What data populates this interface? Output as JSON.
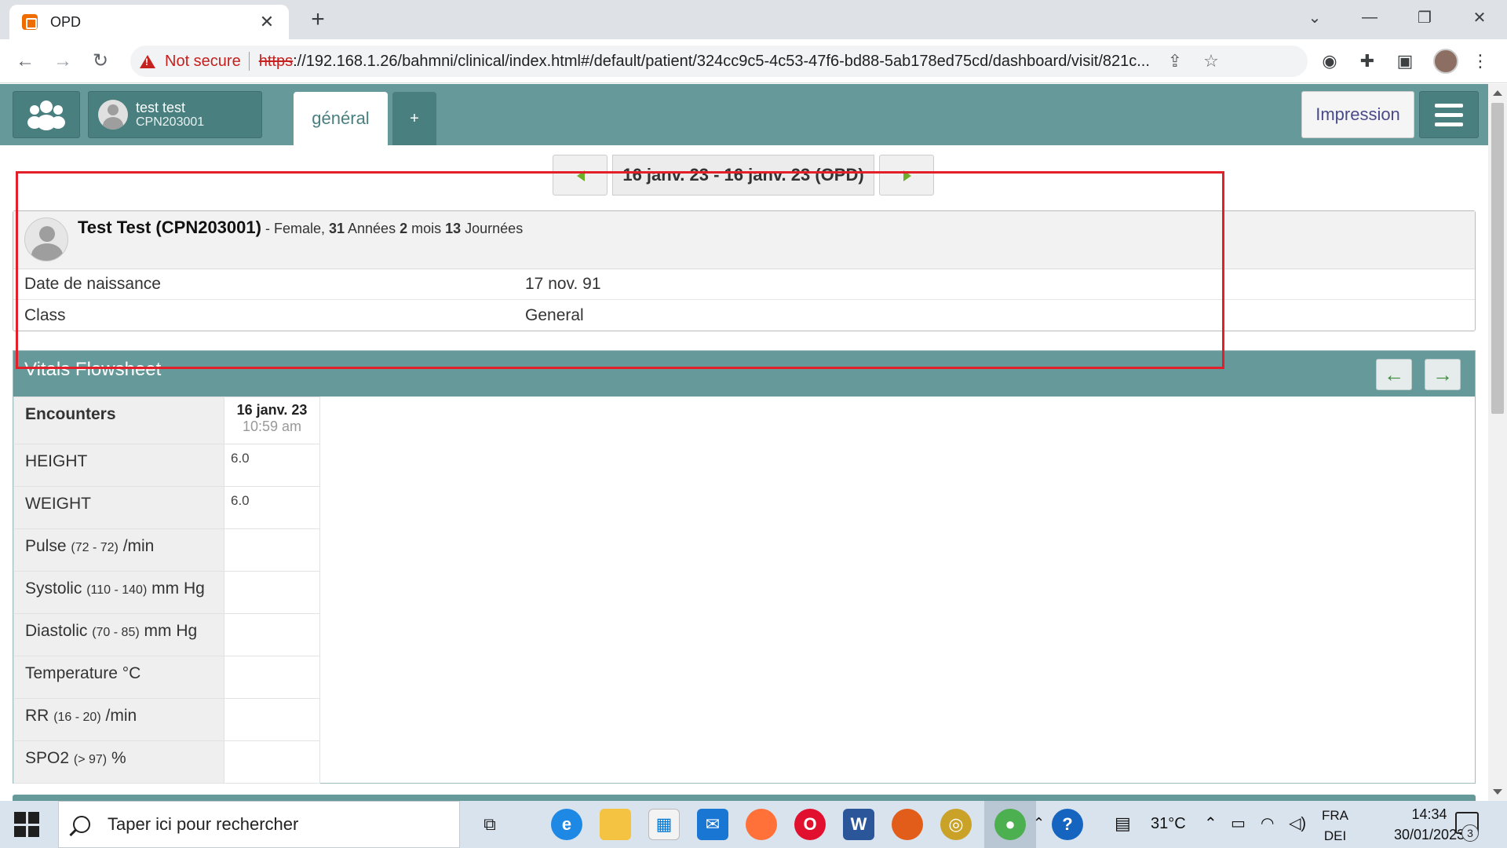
{
  "browser": {
    "tab_title": "OPD",
    "new_tab_label": "+",
    "not_secure": "Not secure",
    "url_scheme": "https",
    "url_rest": "://192.168.1.26/bahmni/clinical/index.html#/default/patient/324cc9c5-4c53-47f6-bd88-5ab178ed75cd/dashboard/visit/821c...",
    "icons": [
      "back-icon",
      "forward-icon",
      "reload-icon",
      "share-icon",
      "star-icon",
      "extensions-icon",
      "sidepanel-icon",
      "menu-icon"
    ]
  },
  "header": {
    "patient_name": "test test",
    "patient_id": "CPN203001",
    "tab_general": "général",
    "tab_add": "+",
    "print_label": "Impression"
  },
  "visit": {
    "label": "16 janv. 23 - 16 janv. 23 (OPD)"
  },
  "patient_card": {
    "name": "Test Test (CPN203001)",
    "sep": " - ",
    "gender": "Female, ",
    "age_years": "31",
    "age_years_unit": " Années ",
    "age_months": "2",
    "age_months_unit": " mois ",
    "age_days": "13",
    "age_days_unit": " Journées",
    "rows": [
      {
        "label": "Date de naissance",
        "value": "17 nov. 91"
      },
      {
        "label": "Class",
        "value": "General"
      }
    ]
  },
  "vitals": {
    "title": "Vitals Flowsheet",
    "encounters_label": "Encounters",
    "encounter_date": "16 janv. 23",
    "encounter_time": "10:59 am",
    "rows": [
      {
        "name": "HEIGHT",
        "range": "",
        "unit": "",
        "value": "6.0"
      },
      {
        "name": "WEIGHT",
        "range": "",
        "unit": "",
        "value": "6.0"
      },
      {
        "name": "Pulse",
        "range": "(72 - 72)",
        "unit": "/min",
        "value": ""
      },
      {
        "name": "Systolic",
        "range": "(110 - 140)",
        "unit": "mm Hg",
        "value": ""
      },
      {
        "name": "Diastolic",
        "range": "(70 - 85)",
        "unit": "mm Hg",
        "value": ""
      },
      {
        "name": "Temperature",
        "range": "",
        "unit": "°C",
        "value": ""
      },
      {
        "name": "RR",
        "range": "(16 - 20)",
        "unit": "/min",
        "value": ""
      },
      {
        "name": "SPO2",
        "range": "(> 97)",
        "unit": "%",
        "value": ""
      }
    ]
  },
  "taskbar": {
    "search_placeholder": "Taper ici pour rechercher",
    "temperature": "31°C",
    "language_top": "FRA",
    "language_bottom": "DEI",
    "time": "14:34",
    "date": "30/01/2023",
    "notification_count": "3"
  },
  "colors": {
    "header_teal": "#669999",
    "annotation_red": "#e3202a",
    "nav_arrow_green": "#6fae2b"
  }
}
